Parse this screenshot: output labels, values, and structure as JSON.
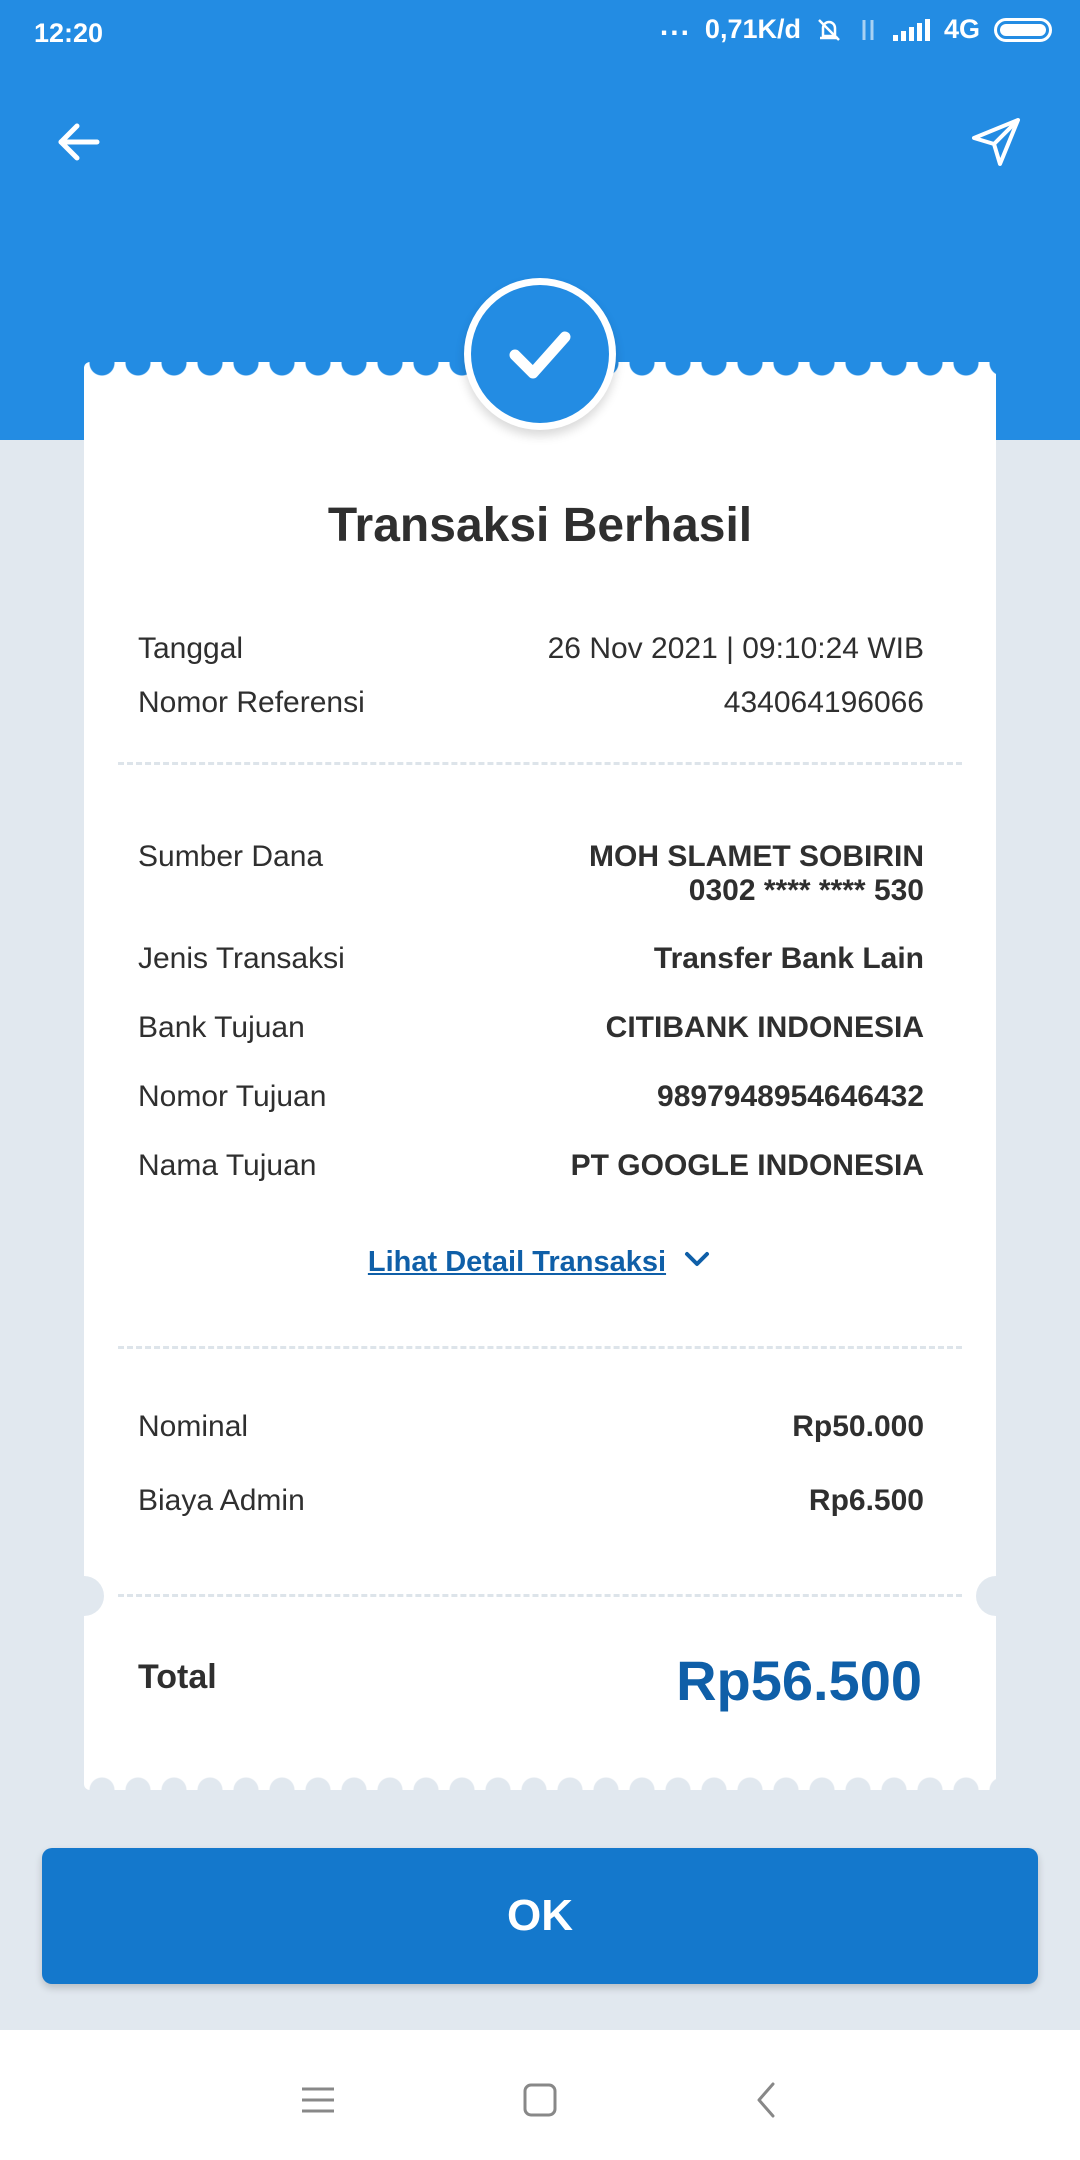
{
  "status_bar": {
    "time": "12:20",
    "dots": "...",
    "speed": "0,71K/d",
    "network": "4G"
  },
  "header": {
    "back_icon": "arrow-left-icon",
    "share_icon": "send-icon"
  },
  "receipt": {
    "title": "Transaksi Berhasil",
    "meta": [
      {
        "label": "Tanggal",
        "value": "26 Nov 2021 | 09:10:24 WIB"
      },
      {
        "label": "Nomor Referensi",
        "value": "434064196066"
      }
    ],
    "details": {
      "source_label": "Sumber Dana",
      "source_name": "MOH SLAMET SOBIRIN",
      "source_account": "0302 **** **** 530",
      "items": [
        {
          "label": "Jenis Transaksi",
          "value": "Transfer Bank Lain"
        },
        {
          "label": "Bank Tujuan",
          "value": "CITIBANK INDONESIA"
        },
        {
          "label": "Nomor Tujuan",
          "value": "9897948954646432"
        },
        {
          "label": "Nama Tujuan",
          "value": "PT GOOGLE INDONESIA"
        }
      ]
    },
    "detail_link": "Lihat Detail Transaksi",
    "amounts": [
      {
        "label": "Nominal",
        "value": "Rp50.000"
      },
      {
        "label": "Biaya Admin",
        "value": "Rp6.500"
      }
    ],
    "total_label": "Total",
    "total_value": "Rp56.500"
  },
  "ok_button": "OK",
  "colors": {
    "primary": "#238ce3",
    "button": "#1478cc",
    "accent_text": "#0f5fa8",
    "background": "#e1e8ef"
  }
}
